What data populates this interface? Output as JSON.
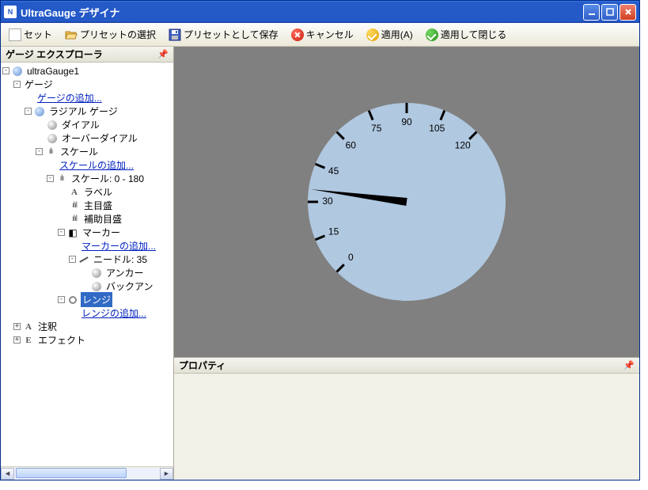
{
  "title": "UltraGauge デザイナ",
  "toolbar": {
    "set": "セット",
    "preset_select": "プリセットの選択",
    "preset_save": "プリセットとして保存",
    "cancel": "キャンセル",
    "apply": "適用(A)",
    "apply_close": "適用して閉じる"
  },
  "explorer": {
    "title": "ゲージ エクスプローラ"
  },
  "tree": {
    "root": "ultraGauge1",
    "gauges": "ゲージ",
    "add_gauge": "ゲージの追加...",
    "radial": "ラジアル ゲージ",
    "dial": "ダイアル",
    "overdial": "オーバーダイアル",
    "scales": "スケール",
    "add_scale": "スケールの追加...",
    "scale_range": "スケール: 0 - 180",
    "labels": "ラベル",
    "major": "主目盛",
    "minor": "補助目盛",
    "markers": "マーカー",
    "add_marker": "マーカーの追加...",
    "needle": "ニードル: 35",
    "anchor": "アンカー",
    "backan": "バックアン",
    "ranges": "レンジ",
    "add_range": "レンジの追加...",
    "annotations": "注釈",
    "effects": "エフェクト"
  },
  "properties": {
    "title": "プロパティ"
  },
  "chart_data": {
    "type": "radial-gauge",
    "scale_min": 0,
    "scale_max": 180,
    "label_interval": 15,
    "tick_values": [
      0,
      15,
      30,
      45,
      60,
      75,
      90,
      105,
      120
    ],
    "needle_value": 35,
    "start_angle_deg": 135,
    "end_angle_deg": 405,
    "face_color": "#b0c8e0"
  }
}
